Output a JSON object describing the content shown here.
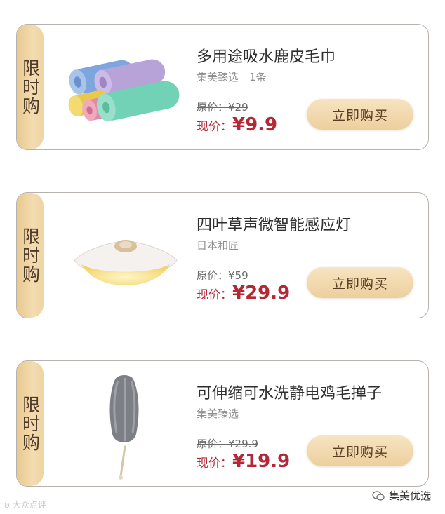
{
  "products": [
    {
      "tag": "限时购",
      "image_icon": "towel-rolls-image",
      "title": "多用途吸水鹿皮毛巾",
      "subtitle": "集美臻选　1条",
      "original_price_label": "原价：",
      "original_price": "¥29",
      "current_price_label": "现价：",
      "current_price": "¥9.9",
      "buy_label": "立即购买"
    },
    {
      "tag": "限时购",
      "image_icon": "induction-lamp-image",
      "title": "四叶草声微智能感应灯",
      "subtitle": "日本和匠",
      "original_price_label": "原价：",
      "original_price": "¥59",
      "current_price_label": "现价：",
      "current_price": "¥29.9",
      "buy_label": "立即购买"
    },
    {
      "tag": "限时购",
      "image_icon": "duster-image",
      "title": "可伸缩可水洗静电鸡毛掸子",
      "subtitle": "集美臻选",
      "original_price_label": "原价：",
      "original_price": "¥29.9",
      "current_price_label": "现价：",
      "current_price": "¥19.9",
      "buy_label": "立即购买"
    }
  ],
  "watermark": {
    "left": "大众点评",
    "right": "集美优选"
  },
  "colors": {
    "tag_gradient": "#e8c98f",
    "price_red": "#b42734",
    "button_gold": "#eccf9d",
    "border": "#b7b2ad"
  }
}
